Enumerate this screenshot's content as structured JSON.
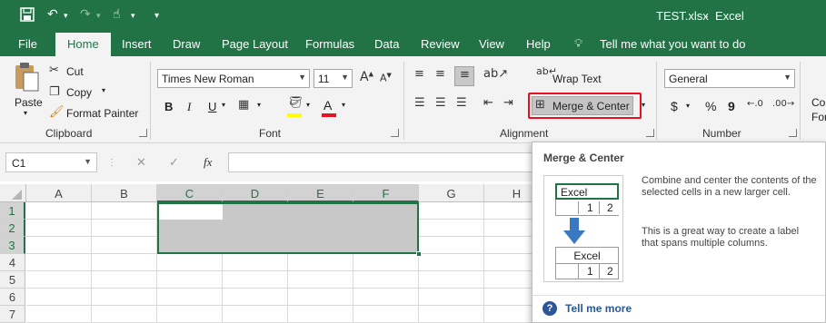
{
  "titlebar": {
    "filename": "TEST.xlsx",
    "separator": "-",
    "app": "Excel"
  },
  "tabs": [
    "File",
    "Home",
    "Insert",
    "Draw",
    "Page Layout",
    "Formulas",
    "Data",
    "Review",
    "View",
    "Help"
  ],
  "tellme": "Tell me what you want to do",
  "clipboard": {
    "paste": "Paste",
    "cut": "Cut",
    "copy": "Copy",
    "format_painter": "Format Painter",
    "label": "Clipboard"
  },
  "font": {
    "name": "Times New Roman",
    "size": "11",
    "label": "Font",
    "bold": "B",
    "italic": "I",
    "underline": "U",
    "font_color": "A",
    "highlight_color": "#ffff00",
    "text_color": "#e81123"
  },
  "alignment": {
    "wrap": "Wrap Text",
    "merge": "Merge & Center",
    "label": "Alignment"
  },
  "number": {
    "format": "General",
    "label": "Number",
    "currency": "$",
    "percent": "%",
    "comma": "9"
  },
  "styles_partial": {
    "line1": "Co",
    "line2": "For"
  },
  "formula": {
    "namebox": "C1",
    "fx": "fx",
    "cancel": "✕",
    "enter": "✓"
  },
  "columns": [
    "A",
    "B",
    "C",
    "D",
    "E",
    "F",
    "G",
    "H"
  ],
  "rows": [
    "1",
    "2",
    "3",
    "4",
    "5",
    "6",
    "7"
  ],
  "tooltip": {
    "title": "Merge & Center",
    "desc1": "Combine and center the contents of the selected cells in a new larger cell.",
    "desc2": "This is a great way to create a label that spans multiple columns.",
    "before": {
      "label": "Excel",
      "v1": "1",
      "v2": "2"
    },
    "after": {
      "label": "Excel",
      "v1": "1",
      "v2": "2"
    },
    "more": "Tell me more"
  },
  "colors": {
    "excel_green": "#217346",
    "highlight_red": "#e81123",
    "selection_gray": "#c8c8c8",
    "help_blue": "#2b579a"
  }
}
